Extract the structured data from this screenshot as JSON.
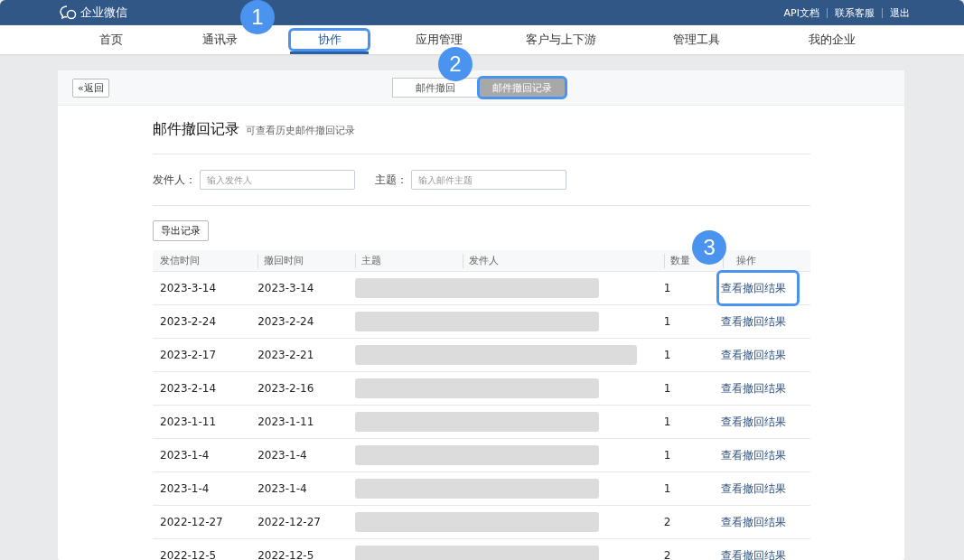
{
  "top_bar": {
    "logo": "企业微信",
    "links": [
      "API文档",
      "联系客服",
      "退出"
    ]
  },
  "nav": {
    "tabs": [
      {
        "label": "首页",
        "selected": false
      },
      {
        "label": "通讯录",
        "selected": false
      },
      {
        "label": "协作",
        "selected": true,
        "highlighted": true,
        "badge": "1"
      },
      {
        "label": "应用管理",
        "selected": false
      },
      {
        "label": "客户与上下游",
        "selected": false
      },
      {
        "label": "管理工具",
        "selected": false
      },
      {
        "label": "我的企业",
        "selected": false
      }
    ]
  },
  "panel": {
    "back_button": "«返回",
    "segments": [
      {
        "label": "邮件撤回",
        "selected": false
      },
      {
        "label": "邮件撤回记录",
        "selected": true,
        "highlighted": true,
        "badge": "2"
      }
    ],
    "title": "邮件撤回记录",
    "subtitle": "可查看历史邮件撤回记录",
    "filters": [
      {
        "label": "发件人：",
        "placeholder": "输入发件人"
      },
      {
        "label": "主题：",
        "placeholder": "输入邮件主题"
      }
    ],
    "export_button": "导出记录",
    "table": {
      "columns": [
        "发信时间",
        "撤回时间",
        "主题",
        "发件人",
        "数量",
        "操作"
      ],
      "rows": [
        {
          "sent": "2023-3-14",
          "recalled": "2023-3-14",
          "count": "1",
          "action": "查看撤回结果",
          "highlighted": true,
          "badge": "3"
        },
        {
          "sent": "2023-2-24",
          "recalled": "2023-2-24",
          "count": "1",
          "action": "查看撤回结果",
          "highlighted": false
        },
        {
          "sent": "2023-2-17",
          "recalled": "2023-2-21",
          "count": "1",
          "action": "查看撤回结果",
          "highlighted": false
        },
        {
          "sent": "2023-2-14",
          "recalled": "2023-2-16",
          "count": "1",
          "action": "查看撤回结果",
          "highlighted": false
        },
        {
          "sent": "2023-1-11",
          "recalled": "2023-1-11",
          "count": "1",
          "action": "查看撤回结果",
          "highlighted": false
        },
        {
          "sent": "2023-1-4",
          "recalled": "2023-1-4",
          "count": "1",
          "action": "查看撤回结果",
          "highlighted": false
        },
        {
          "sent": "2023-1-4",
          "recalled": "2023-1-4",
          "count": "1",
          "action": "查看撤回结果",
          "highlighted": false
        },
        {
          "sent": "2022-12-27",
          "recalled": "2022-12-27",
          "count": "2",
          "action": "查看撤回结果",
          "highlighted": false
        },
        {
          "sent": "2022-12-5",
          "recalled": "2022-12-5",
          "count": "2",
          "action": "查看撤回结果",
          "highlighted": false
        }
      ]
    }
  }
}
